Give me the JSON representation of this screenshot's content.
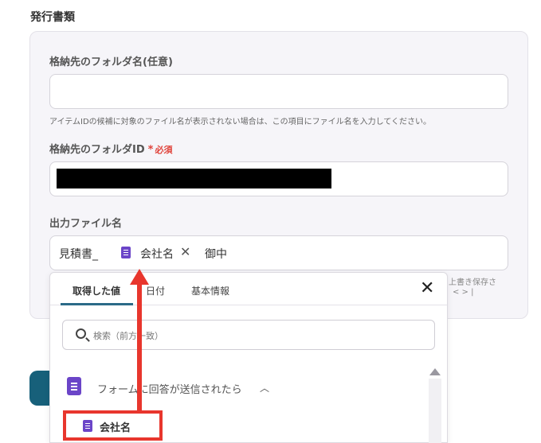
{
  "section": {
    "title": "発行書類"
  },
  "folder_name": {
    "label": "格納先のフォルダ名(任意)",
    "value": "",
    "help": "アイテムIDの候補に対象のファイル名が表示されない場合は、この項目にファイル名を入力してください。"
  },
  "folder_id": {
    "label": "格納先のフォルダID",
    "required_star": "*",
    "required_text": "必須"
  },
  "output": {
    "label": "出力ファイル名",
    "prefix": "見積書_",
    "chip_label": "会社名",
    "suffix": "御中",
    "clipped_help_1": "上書き保存さ",
    "clipped_help_2": "< > |"
  },
  "dropdown": {
    "tabs": [
      "取得した値",
      "日付",
      "基本情報"
    ],
    "search_placeholder": "検索（前方一致）",
    "group_label": "フォームに回答が送信されたら",
    "item_label": "会社名"
  },
  "colors": {
    "accent_red": "#e8362d",
    "doc_purple": "#6b45c8",
    "tab_underline": "#2b6a88"
  }
}
